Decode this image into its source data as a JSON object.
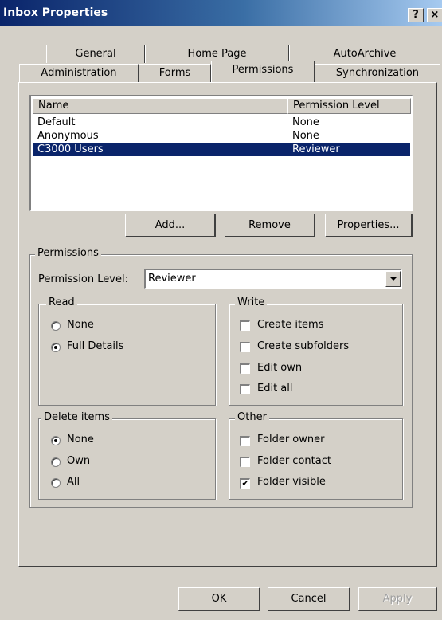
{
  "window": {
    "title": "Inbox Properties",
    "help_label": "?",
    "close_label": "×"
  },
  "tabs": {
    "row1": [
      "General",
      "Home Page",
      "AutoArchive"
    ],
    "row2": [
      "Administration",
      "Forms",
      "Permissions",
      "Synchronization"
    ],
    "active": "Permissions"
  },
  "list": {
    "columns": [
      "Name",
      "Permission Level"
    ],
    "rows": [
      {
        "name": "Default",
        "level": "None"
      },
      {
        "name": "Anonymous",
        "level": "None"
      },
      {
        "name": "C3000 Users",
        "level": "Reviewer",
        "selected": true
      }
    ]
  },
  "buttons": {
    "add": "Add...",
    "remove": "Remove",
    "properties": "Properties...",
    "ok": "OK",
    "cancel": "Cancel",
    "apply": "Apply"
  },
  "permissions": {
    "group_label": "Permissions",
    "level_label": "Permission Level:",
    "level_value": "Reviewer",
    "read": {
      "label": "Read",
      "none": "None",
      "full_details": "Full Details",
      "selected": "full_details"
    },
    "write": {
      "label": "Write",
      "create_items": "Create items",
      "create_subfolders": "Create subfolders",
      "edit_own": "Edit own",
      "edit_all": "Edit all"
    },
    "delete": {
      "label": "Delete items",
      "none": "None",
      "own": "Own",
      "all": "All",
      "selected": "none"
    },
    "other": {
      "label": "Other",
      "folder_owner": "Folder owner",
      "folder_contact": "Folder contact",
      "folder_visible": "Folder visible",
      "folder_visible_checked": true
    }
  }
}
